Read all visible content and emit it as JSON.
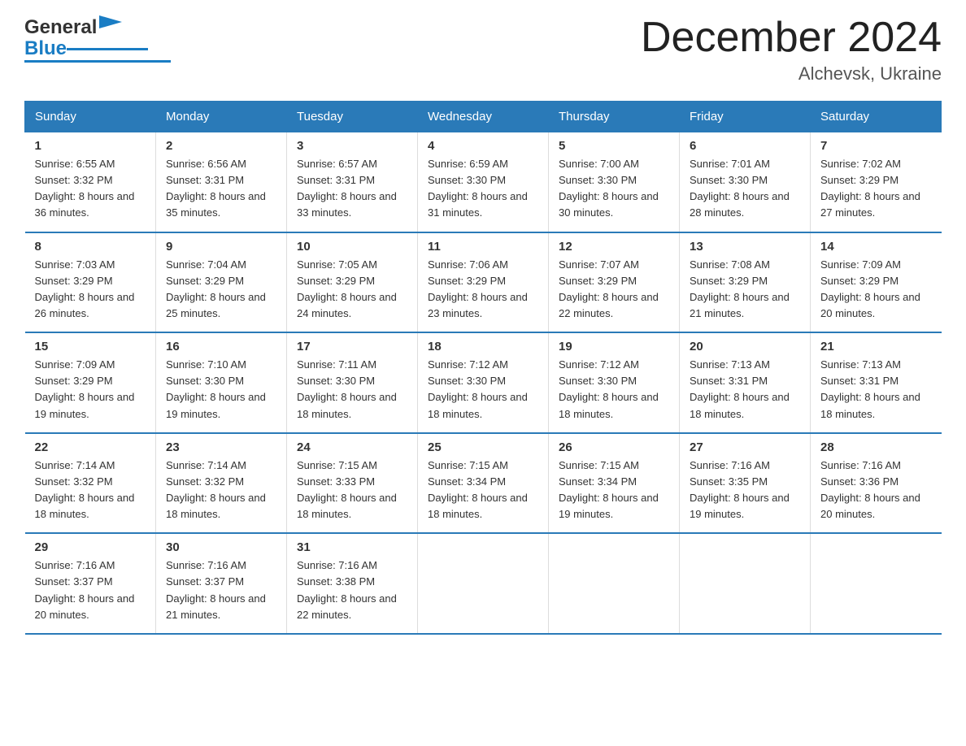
{
  "header": {
    "logo_general": "General",
    "logo_blue": "Blue",
    "title": "December 2024",
    "location": "Alchevsk, Ukraine"
  },
  "days_of_week": [
    "Sunday",
    "Monday",
    "Tuesday",
    "Wednesday",
    "Thursday",
    "Friday",
    "Saturday"
  ],
  "weeks": [
    [
      {
        "num": "1",
        "sunrise": "Sunrise: 6:55 AM",
        "sunset": "Sunset: 3:32 PM",
        "daylight": "Daylight: 8 hours and 36 minutes."
      },
      {
        "num": "2",
        "sunrise": "Sunrise: 6:56 AM",
        "sunset": "Sunset: 3:31 PM",
        "daylight": "Daylight: 8 hours and 35 minutes."
      },
      {
        "num": "3",
        "sunrise": "Sunrise: 6:57 AM",
        "sunset": "Sunset: 3:31 PM",
        "daylight": "Daylight: 8 hours and 33 minutes."
      },
      {
        "num": "4",
        "sunrise": "Sunrise: 6:59 AM",
        "sunset": "Sunset: 3:30 PM",
        "daylight": "Daylight: 8 hours and 31 minutes."
      },
      {
        "num": "5",
        "sunrise": "Sunrise: 7:00 AM",
        "sunset": "Sunset: 3:30 PM",
        "daylight": "Daylight: 8 hours and 30 minutes."
      },
      {
        "num": "6",
        "sunrise": "Sunrise: 7:01 AM",
        "sunset": "Sunset: 3:30 PM",
        "daylight": "Daylight: 8 hours and 28 minutes."
      },
      {
        "num": "7",
        "sunrise": "Sunrise: 7:02 AM",
        "sunset": "Sunset: 3:29 PM",
        "daylight": "Daylight: 8 hours and 27 minutes."
      }
    ],
    [
      {
        "num": "8",
        "sunrise": "Sunrise: 7:03 AM",
        "sunset": "Sunset: 3:29 PM",
        "daylight": "Daylight: 8 hours and 26 minutes."
      },
      {
        "num": "9",
        "sunrise": "Sunrise: 7:04 AM",
        "sunset": "Sunset: 3:29 PM",
        "daylight": "Daylight: 8 hours and 25 minutes."
      },
      {
        "num": "10",
        "sunrise": "Sunrise: 7:05 AM",
        "sunset": "Sunset: 3:29 PM",
        "daylight": "Daylight: 8 hours and 24 minutes."
      },
      {
        "num": "11",
        "sunrise": "Sunrise: 7:06 AM",
        "sunset": "Sunset: 3:29 PM",
        "daylight": "Daylight: 8 hours and 23 minutes."
      },
      {
        "num": "12",
        "sunrise": "Sunrise: 7:07 AM",
        "sunset": "Sunset: 3:29 PM",
        "daylight": "Daylight: 8 hours and 22 minutes."
      },
      {
        "num": "13",
        "sunrise": "Sunrise: 7:08 AM",
        "sunset": "Sunset: 3:29 PM",
        "daylight": "Daylight: 8 hours and 21 minutes."
      },
      {
        "num": "14",
        "sunrise": "Sunrise: 7:09 AM",
        "sunset": "Sunset: 3:29 PM",
        "daylight": "Daylight: 8 hours and 20 minutes."
      }
    ],
    [
      {
        "num": "15",
        "sunrise": "Sunrise: 7:09 AM",
        "sunset": "Sunset: 3:29 PM",
        "daylight": "Daylight: 8 hours and 19 minutes."
      },
      {
        "num": "16",
        "sunrise": "Sunrise: 7:10 AM",
        "sunset": "Sunset: 3:30 PM",
        "daylight": "Daylight: 8 hours and 19 minutes."
      },
      {
        "num": "17",
        "sunrise": "Sunrise: 7:11 AM",
        "sunset": "Sunset: 3:30 PM",
        "daylight": "Daylight: 8 hours and 18 minutes."
      },
      {
        "num": "18",
        "sunrise": "Sunrise: 7:12 AM",
        "sunset": "Sunset: 3:30 PM",
        "daylight": "Daylight: 8 hours and 18 minutes."
      },
      {
        "num": "19",
        "sunrise": "Sunrise: 7:12 AM",
        "sunset": "Sunset: 3:30 PM",
        "daylight": "Daylight: 8 hours and 18 minutes."
      },
      {
        "num": "20",
        "sunrise": "Sunrise: 7:13 AM",
        "sunset": "Sunset: 3:31 PM",
        "daylight": "Daylight: 8 hours and 18 minutes."
      },
      {
        "num": "21",
        "sunrise": "Sunrise: 7:13 AM",
        "sunset": "Sunset: 3:31 PM",
        "daylight": "Daylight: 8 hours and 18 minutes."
      }
    ],
    [
      {
        "num": "22",
        "sunrise": "Sunrise: 7:14 AM",
        "sunset": "Sunset: 3:32 PM",
        "daylight": "Daylight: 8 hours and 18 minutes."
      },
      {
        "num": "23",
        "sunrise": "Sunrise: 7:14 AM",
        "sunset": "Sunset: 3:32 PM",
        "daylight": "Daylight: 8 hours and 18 minutes."
      },
      {
        "num": "24",
        "sunrise": "Sunrise: 7:15 AM",
        "sunset": "Sunset: 3:33 PM",
        "daylight": "Daylight: 8 hours and 18 minutes."
      },
      {
        "num": "25",
        "sunrise": "Sunrise: 7:15 AM",
        "sunset": "Sunset: 3:34 PM",
        "daylight": "Daylight: 8 hours and 18 minutes."
      },
      {
        "num": "26",
        "sunrise": "Sunrise: 7:15 AM",
        "sunset": "Sunset: 3:34 PM",
        "daylight": "Daylight: 8 hours and 19 minutes."
      },
      {
        "num": "27",
        "sunrise": "Sunrise: 7:16 AM",
        "sunset": "Sunset: 3:35 PM",
        "daylight": "Daylight: 8 hours and 19 minutes."
      },
      {
        "num": "28",
        "sunrise": "Sunrise: 7:16 AM",
        "sunset": "Sunset: 3:36 PM",
        "daylight": "Daylight: 8 hours and 20 minutes."
      }
    ],
    [
      {
        "num": "29",
        "sunrise": "Sunrise: 7:16 AM",
        "sunset": "Sunset: 3:37 PM",
        "daylight": "Daylight: 8 hours and 20 minutes."
      },
      {
        "num": "30",
        "sunrise": "Sunrise: 7:16 AM",
        "sunset": "Sunset: 3:37 PM",
        "daylight": "Daylight: 8 hours and 21 minutes."
      },
      {
        "num": "31",
        "sunrise": "Sunrise: 7:16 AM",
        "sunset": "Sunset: 3:38 PM",
        "daylight": "Daylight: 8 hours and 22 minutes."
      },
      null,
      null,
      null,
      null
    ]
  ]
}
